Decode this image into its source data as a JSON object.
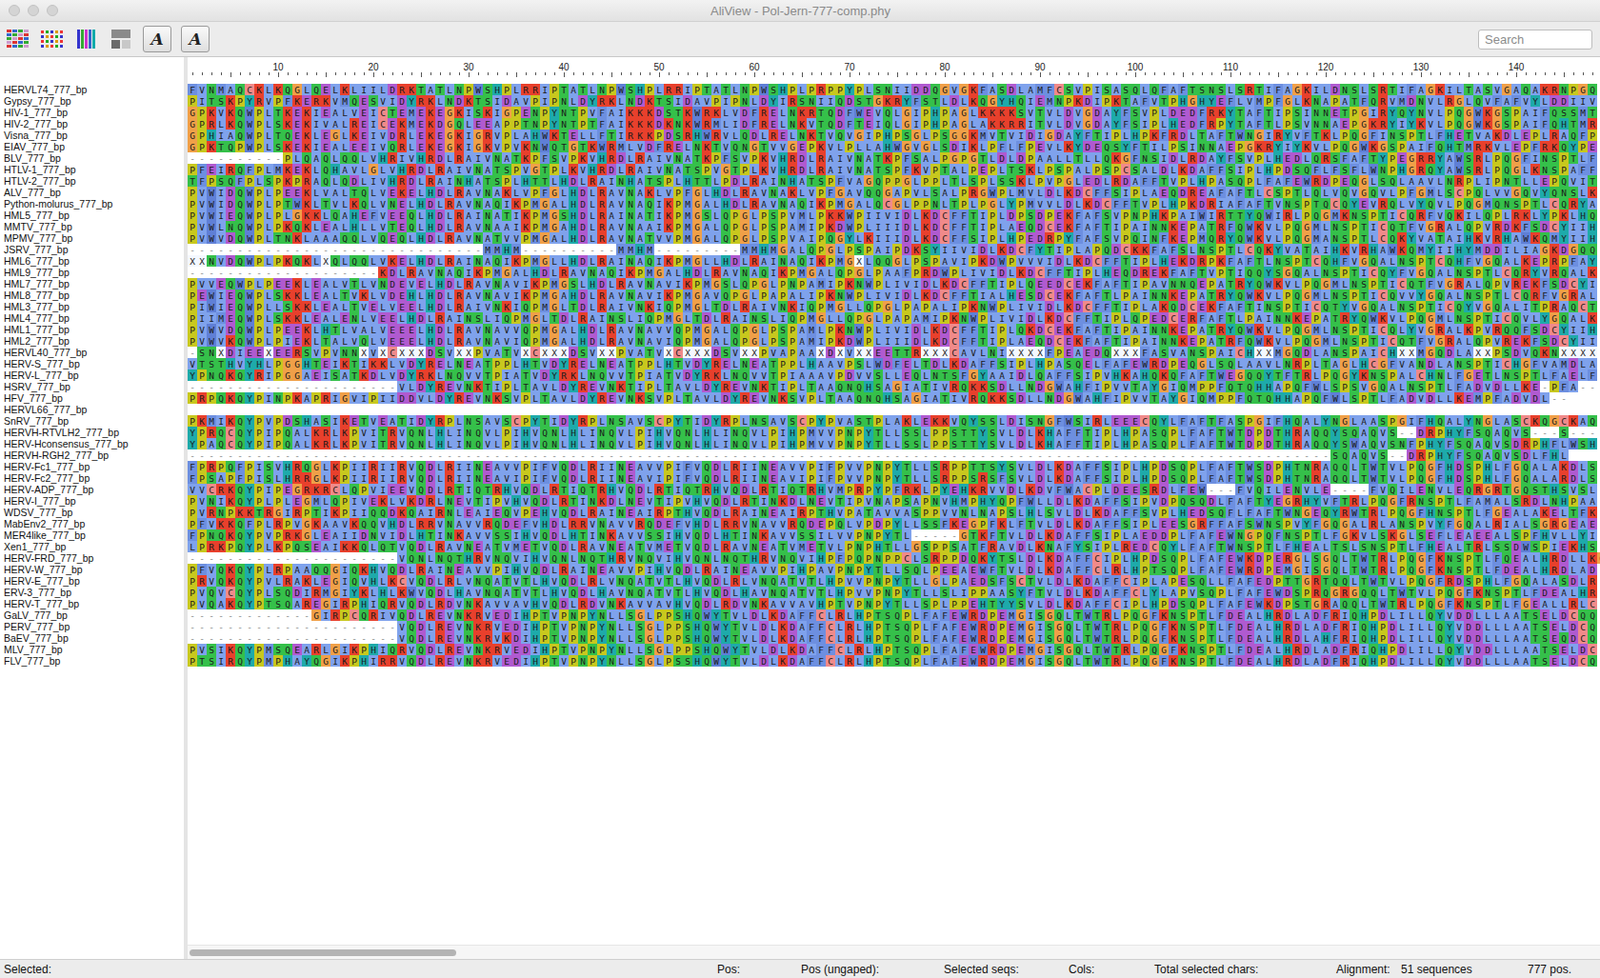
{
  "window": {
    "title": "AliView - Pol-Jern-777-comp.phy"
  },
  "toolbar": {
    "font_buttons": [
      "A",
      "A"
    ]
  },
  "search": {
    "placeholder": "Search"
  },
  "ruler": {
    "labels": [
      "10",
      "20",
      "30",
      "40",
      "50",
      "60",
      "70",
      "80",
      "90",
      "100",
      "110",
      "120",
      "130",
      "140"
    ]
  },
  "sequences": [
    {
      "name": "HERVL74_777_bp",
      "residues": "FVNMAQCKLKQGLQELKLIILDRKTATLNPWSHPLRRIPTATLNPWSHPLRRIPTATLNPWSHPLPRPPYPLSNIIDDQGVGKFASDLAMFCSVPISASQLQFAFTSNSLSRTIFAGKILDNSLSRTIFAGKILTASVGAQAKRNPGQ"
    },
    {
      "name": "Gypsy_777_bp",
      "residues": "PITSKPYRVPFKERKVMQESVIDYRKLNDKTSIDAVPIPNLDYRKLNDKTSIDAVPIPNLDYIRSNIIQDSTGKRYFSTLDLKQGYHQIEMNPKDIPKTAFVTPHGHYEFLVMPFGLKNAPATFQRVMDNVLRGLQVFAFVYLDDIIV"
    },
    {
      "name": "HIV-1_777_bp",
      "residues": "GPKVKQWPLTKEKIEALVEICTEMEKEGKISKIGPENPYNTPVFAIKKKDSTKWRKLVDFRELNKRTQDFWEVQLGIPHPAGLKKKKSVTVLDVGDAYFSVPLDEDFRKYTAFTIPSINNETPGIRYQYNVLPQGWKGSPAIFQSSMT"
    },
    {
      "name": "HIV-2_777_bp",
      "residues": "GPRLKQWPLSKEKIVALREICEKMEKDGQLEEAPPTNPYNTPTFAIKKKDKNKWRMLIDFRELNKVTQDFTEIQLGIPHPAGLAKKRRITVLDVGDAYFSIPLHEDFRPYTAFTLPSVNNAEPGKRYIYKVLPQGWKGSPAIFQHTMR"
    },
    {
      "name": "Visna_777_bp",
      "residues": "GPHIAQWPLTQEKLEGLKEIVDRLEKEGKIGRVPLAHWKTELLFTIRKKPDSRHWRVLQDLRELNKTVQVGIPHPSGLPSGGKMVTVIDIGDAYFTIPLHPKFRDLTAFTWNGIRYVFTKLPQGFINSPTLFHETVAKDLEPLRAQFP"
    },
    {
      "name": "EIAV_777_bp",
      "residues": "GPKTQPWPLSKEKIEALEEIVQRLEKEGKIGKVPVKNWQTGTKWRMLVDFRELNKTVQNGTVVGEPKVLPLLAHWGVGLSDIKLPFLFPEVLKYDEQSYFTILPSINNAEPGKRYIYKVLPQGWKGSPAIFQHTMRKVLEPFRKQYPE"
    },
    {
      "name": "BLV_777_bp",
      "residues": "----------PLQAQLQQLVHRIVHRDLRAIVNATKPFSVPKVHRDLRAIVNATKPFSVPKVHRDLRAIVNATKPFSALPGPGTLDLDPAALLTLLQKGFNSIDLRDAYFSVPLHEDLQRSFAFTYPEGRRYAWSRLPQGFINSPTLF"
    },
    {
      "name": "HTLV-1_777_bp",
      "residues": "PFEIRQFPLMKEKLQHAVLGLVHRDLRAIVNATSPVGTPLKVHRDLRAIVNATSPVGTPLKVHRDLRAIVNATSPFKVPTALPEPLTSKLPSPALPSPCSALDLKDAFFSIPLHPDSQFLFSFLWNPHGRQYAWSRLPQGLKNSPAFF"
    },
    {
      "name": "HTLV-2_777_bp",
      "residues": "TFPSQFPLSPKPRAQLQDLIVHRDLRAINHATSPLHTTLHDLRAINHATSPLHTTLPDLRAINHATSPFVAGQPPGLPPLTLSPLSSKLPVPGLEDLRDAFFTVPLHPASQPLFAFEWRDPEQGLSQLAAVLNRPLIPNTLLEPQVIT"
    },
    {
      "name": "ALV_777_bp",
      "residues": "PVWIDQWPLPEEKLVALTQLVEKELHDLRAVNAKLVPFGLHDLRAVNAKLVPFGLHDLRAVNAKLVPFGAVQQGAPVLSALPRGWPLMVLDLKDCFFSIPLAEQDREAFAFTLCSPTLQLVQVGQVLPFGMLSCPQLVVGQVYQNSLK"
    },
    {
      "name": "Python-molurus_777_bp",
      "residues": "PVWIDQWPLPTWKLTVLKQLVNELHDLRAVNAQIKPMGALHDLRAVNAQIKPMGALHDLRAVNAQIKPMGALQCGLPPNLTPLPGLYPMVVLDLKDCFFTVPLHPKDRIAFAFTVNSPTQCQYEVRQLVYQVLPQGMQNSPTLCQRYA"
    },
    {
      "name": "HML5_777_bp",
      "residues": "PVWIEQWPLPLGKKLQAHEFVEEQLHDLRAINATIKPMGSHDLRAINATIKPMGSLQPGLPSPVMLPKKWPIIVIDLKDCFFTIPLDPSDPEKFAFSVPNPHKPAIWIRTTYQWIRLPQGMKNSPTICQRFVQKILQPLRKLYPKLHQ"
    },
    {
      "name": "MMTV_777_bp",
      "residues": "PVWLNQWPLPKQKLEALHLLVTEQLHDLRAVNAAIKPMGAHDLRAVNAAIKPMGALQPGLPSPAMIPKDWPLIIIDLKDCFFTIPLAEQDCEKFAFTIPAINNKEPATRFQWKVLPQGMLNSPTICQTFVGRALQPVRDKFSDCYIIH"
    },
    {
      "name": "MPMV_777_bp",
      "residues": "PVWVDQWPLTNKLAAAQQLVQEQLHDLRAVNATVVPMGALHDLRAVNATVVPMGALQPGLPSPVAIPQGYLKIIIDLKDCFFSIPLHPEDRPYFAFSVPQINFKEPMQRYQWKVLPQGMANSPTLCQKYVATAIHKVRHAWKQMYIIH"
    },
    {
      "name": "JSRV_777_bp",
      "residues": "-------------------------------MMHM----------MMHM---------MMHMGALQPGLPSPAIPDKSYIIVIDLKDCFYTIPLAPQDCKKFAFSLNSPTLCQKYVATAIHKVRHAWKQMYIIHYMDDILIAGKDGQQ"
    },
    {
      "name": "HML6_777_bp",
      "residues": "XXNVDQWPLPKQKLXQLQQLVKELHDLRAINAQIKPMGLLHDLRAINAQIKPMGLLHDLRAINAQIKPMGXLQQGLPSPAVIPKDWPVVVIDLKDCFFTIPLHEKDRPKFAFTLNSPTCQHFVGQALNSPTCQHFVGQALKEPRPFAY"
    },
    {
      "name": "HML9_777_bp",
      "residues": "--------------------KDLRAVNAQIKPMGALHDLRAVNAQIKPMGALHDLRAVNAQIKPMGALQPGLPAAFPRDWPLIVIDLKDCFFTIPLHEQDREKFAFTVPTIQQYSGQALNSPTICQYFVGQALNSPTLCQRYVRQALK"
    },
    {
      "name": "HML7_777_bp",
      "residues": "PVVEQWPLPEEKLEALVTLVNDEVELHDLRAVNAVIKPMGSLHDLRAVNAVIKPMGSLQPGLPNPAMIPKNWPLIVIDLKDCFFTIPLQEEDCEKFAFTIPAVNNQEPATRYQWKVLPQGMLNSPTICQTFVGRALQPVREKFSDCYI"
    },
    {
      "name": "HML8_777_bp",
      "residues": "PEWIEQWPLSKKLEALTVKLVDEHLHDLRAVNAVIKPMGAHDLRAVNAVIKPMGAVQPGLPAPALIPKNWPLIVIDLKDCFFTIALHESDCEKFAFTLPAINNKEPATRYQWKVLPQGMLNSPTICQVVYGQALNSPTLCQRFVGRAL"
    },
    {
      "name": "HML3_777_bp",
      "residues": "PIWIEQWPLLSKKLEALTVELVEELHDLRAIVNKIQPMGLTDLRAIVNKIQPMGLTDLRAIVNKIQPMGLLQPGLPAPALIPKNWPLIVIDLKDCFFTIPLAKQDCEKFAFTINSPTICQTYVGQALNSPTICQYVGQALITPRAQCT"
    },
    {
      "name": "HML4_777_bp",
      "residues": "PIIMEQWPLSKKLEALENLVEELHDLRAINSLIQPMGLTDLRAINSLIQPMGLTDLRAINSLIQPMGLLQPGLPAPAMIPKNWPLIVIDLKDCFFTIPLQPEDCERFAFTLPAINNKEPATRYQWKVLPQGMLNSPTICQVLYGQALK"
    },
    {
      "name": "HML1_777_bp",
      "residues": "PVWVDQWPLPEEKLHTLVALVEEELHDLRAVNAVVQPMGALHDLRAVNAVVQPMGALQPGLPSPAMLPKNWPLIVIDLKDCFFTIPLQKDCEKFAFTIPAINNKEPATRYQWKVLPQGMLNSPTICQLYVGRALKPVRQQFSDCYIIH"
    },
    {
      "name": "HML2_777_bp",
      "residues": "PVWVKQWPLPIEKLTALVQLVEEELHDLRAVNAVIQPMGALHDLRAVNAVIQPMGALQPGLPSPAMIPKDWPLIIIDLKDCFFTIPLAEQDCEKFAFTIPAINNKEPATRFQWKVLPQGMLNSPTICQTFVGRALQPVREKFSDCYII"
    },
    {
      "name": "HERVL40_777_bp",
      "residues": "-SNXDIEEXEERSVPVNNXVXCXXXDSVXXPVATVXCXXXDSVXXPVATVXCXXXDSVXXPVAPAAXDXVXXEETTRXXXCAVLNIXXXXFPEAEDQXXXFASVANSPAICHXXMGQDLANSPAICHXXMGQDLAXXPSDVQKNXXXX"
    },
    {
      "name": "HERV-S_777_bp",
      "residues": "VTSTHVYHLPGGHTEIKTIKKLVDYRELNEATPPLHTVDYRELNEATPPLHTVDYRELNEATPPLHAAVPSLWDFELTDLKDAFFSIPLHPASQELFAFEWRDPEQGLSQLAAVLNRPLTAGLHCGFVANDLANSPTICHGFVAMDLA"
    },
    {
      "name": "HERV-L_777_bp",
      "residues": "YPNQKQYRIPGGAEISATKDLVDYRKLNQVVTPIATVDYRKLNQVVTPIATVDYRKLNQVVTPIAAAVPDVVSLLEQLNTSFGYAAIDLQAFFSIPVHKAHQKQFAFTWEGQQYTFTRLPQGYKNSPALCHNLFGETLNSPTLFAELF"
    },
    {
      "name": "HSRV_777_bp",
      "residues": "----------------------VLDYREVNKTIPLTAVLDYREVNKTIPLTAVLDYREVNKTIPLTAAQNQHSAGIATIVRQKKSDLLNDGWAHFIPVVTAYGIQMPPFQTQHHAPQFWLSPSVGQALNSPTLFADVDLLKE-PFA---"
    },
    {
      "name": "HFV_777_bp",
      "residues": "PRPQKQYPINPKAPRIGVIPIIDDVLDYREVNKSVPLTAVLDYREVNKSVPLTAVLDYREVNKSVPLTAAQNQHSAGIATIVRQKKSDLLNDGWAHFIPVVTAYGIQMPPFQTQHHAPQFWLSPTLFADVDLLKEMPFADVDL--"
    },
    {
      "name": "HERVL66_777_bp",
      "residues": ""
    },
    {
      "name": "SnRV_777_bp",
      "residues": "PKMIKQYPVPDSHASIKETVEATIDYRPLNSAVSCPYTIDYRPLNSAVSCPYTIDYRPLNSAVSCPYPVASTPLAKLEKKVQYSSLDISNGFWSIRLEEECQYLFAFTFASPGIFHQALYNGLAASPGIFHQALYNGLASCKQGCKAQ"
    },
    {
      "name": "HERVH-RTVLH2_777_bp",
      "residues": "YPRQCQYPIPQALKRLKPVITRVQNLHLINQVLPIHVQNLHLINQVLPIHVQNLHLINQVLPIHPMVVPNPYTLLSSLPPSTTYSVLDLKHAFFTIPLHPASQPLFAFTWTDPDTHRAQQYSQAQVS--DRPHYFSQAQVS---S---"
    },
    {
      "name": "HERV-Hconsensus_777_bp",
      "residues": "YPAQCQYPIPQALKRLKPVITRVQNLHLINQVLPIHVQNLHLINQVLPIHVQNLHLINQVLPIHPMVVPNPYTLLSSLPPSTTYSVLDLKHAFFTIPLHPASQPLFAFTWTDPDTHRAQQYSWAQVSNFPHYFSQAQVSDRPHFLWSH"
    },
    {
      "name": "HERVH-RGH2_777_bp",
      "residues": "------------------------------------------------------------------------------------------------------------------------SQAQVS--DRPHYFSQAQVSDLFHL"
    },
    {
      "name": "HERV-Fc1_777_bp",
      "residues": "FPRPQFPISVHRQGLKPIIRIIRVQDLRIINEAVVPIFVQDLRIINEAVVPIFVQDLRIINEAVVPIFPVVPNPYTLLSRPPTTSYSVLDLKDAFFSIPLHPDSQPLFAFTWSDPHTNRAQQLTWTVLPQGFHDSPHLFGQALAKDLS"
    },
    {
      "name": "HERV-Fc2_777_bp",
      "residues": "FPSAPFPISLHRRGLKPIIRIIRVQDLRIINEAVIPIFVQDLRIINEAVIPIFVQDLRIINEAVIPIFPVVPNPYTLLSRPPSRSFSVLDLKDAFFSIPLHPDSQPLFAFTWSDPHTNRAQQLTWTVLPQGFHDSPHLFGQALARDLS"
    },
    {
      "name": "HERV-ADP_777_bp",
      "residues": "VVCRKQYPIPEGRKRCLQPVIEEVQDLRTIQTRHVQDLRTIQTRHVQDLRTIQTRHVQDLRTIQTRHVMPRPYPFRKLPYEHKRVVDLKDVFWACPLDEESRDLFEW---FVQILENVLE----FVQILENVLEQRGRTGQSTHSVSL"
    },
    {
      "name": "HERV-I_777_bp",
      "residues": "PVNIKQYPLPLEGMLQPIVEKLVKDRLNEVTIPVHVQDLRTINKDLNEVTIPVHVQDLRTINKDLNEVTIPVNAPSAPNVHMPHYQPFWLLDLKDAFFSIPVDPQSQDLFAFTYEGRHYVFTRLPQGFRNSPTLFAMALSRDLNHPAA"
    },
    {
      "name": "WDSV_777_bp",
      "residues": "PVRNPKKTRGIRPTIKPIIQQDKQAIRNLEAIEQVPEHVQDLRAINEAIRPTHVQDLRAINEAIRPTHVPATAVVASPPVVNLNAPSLHLSVLDLKDAFFSVPLHEDSQFLFAFTWNGEQYRWTRLPQGFHNSPTLFGEALAKELTFK"
    },
    {
      "name": "MabEnv2_777_bp",
      "residues": "PFVKKQFPLRPVGKAAVKQQVHDLRRVNAVVRQDEFVHDLRRVNAVVRQDEFVHDLRRVNAVVRQDEPQLVPDPYLLSSFKEGPFKLFTVLDLKDAFFSIPLEESGRFFAFSWNSPVYFGQGALRLANSPVYFGQALRIALSGRGEAE"
    },
    {
      "name": "MER4like_777_bp",
      "residues": "FPNQKQYPVPRKGLEAIIDNVIDLHTINKAVVSSIHVQDLHTINKAVVSSIHVQDLHTINKAVVSSILVVPNPYTL-----GTKFTVLDLKDAFFSIPLAEDDPLFAFEWNGPQFNSPTLFGKVLSKGLSEFLEAEEALSPFHVLLYI"
    },
    {
      "name": "Xen1_777_bp",
      "residues": "LPRKPQYPLKPQSEAIKKQLQTVQDLRAVNEATVMETVQDLRAVNEATVMETVQDLRAVNEATVMETVLPNPHTLLGSPPSATFRAVDLKNAFYSIPLREDCQYLFAFTWNSPTLFHEALTSLSNSPTLFHEALTRLSSDWSPIEKHS"
    },
    {
      "name": "HERV-FRD_777_bp",
      "residues": "----------------------VQNLNQTHRVNQVIHVQNLNQTHRVNQVIHVQNLNQTHRVNQVIHPFPQPNPPCLSRPPDQKYTSLDLKDAFFCIPLHPDSQPLFAFEWKDPERGLSGQLTWTRLPQGFKNSPTLFQEALHRDLLKGG"
    },
    {
      "name": "HERV-W_777_bp",
      "residues": "PFVQKQYPLRPAAQQGIQKHVQDLRAINEAVVPIHVQDLRAINEAVVPIHVQDLRAINEAVVPIHPAVPNPYTLLSQLPEEAEWFTVLDLKDAFFCLRLHPTSQPLFAFEWRDPEMGISGQLTWTRLPQGFKNSPTLFDEALHRDLAD"
    },
    {
      "name": "HERV-E_777_bp",
      "residues": "PRVQKQYPVLRAKLEGIQVHLKCVQDLRLVNQATVTLHVQDLRLVNQATVTLHVQDLRLVNQATVTLHPVVPNPYTLLGLPAEDSFSCTVLDLKDAFFCIPLAPESQLLFAFEDPTTGRTQQLTWTVLPQGFRDSPHLFGQALASDLR"
    },
    {
      "name": "ERV-3_777_bp",
      "residues": "PVQVCQYPLSQDIRMGIYKLHLKWVQDLHAVNQATVTLHVQDLHAVNQATVTLHVQDLHAVNQATVTLHPVVPNPYTLLSLIPPAASYFTVLDLKDAFFCLYLAPVSQPLFAFEWDSPRQGRGQQLTWTVLPQGFKNSPTLFDEALHR"
    },
    {
      "name": "HERV-T_777_bp",
      "residues": "PVQAKQYPTSQAREGIRPHIQRVQDLRDVNKAVVAVHVQDLRDVNKAVVAVHVQDLRDVNKAVVAVHPTVPNPYTLLSPLPPEHTYYSVLDLKDAFFCIPLHPDSQPLFAFEWKDPSTGRAQQLTWTRLPQGFKNSPTLFGEALLRLC"
    },
    {
      "name": "GaLV_777_bp",
      "residues": "-------------GIRPCQRIVQDLREVNKRVEDIHPTVPNPYNLLSGLPPSHQWYTVLDLKDAFFCLRLHPTSQPLFAFEWRDPEMGISGQLTWTRLPQGFKNSPTLFDEALHRDLADFRIQHPDLILLQYVDDLLLAATSELDCQQ"
    },
    {
      "name": "PERV_777_bp",
      "residues": "----------------------VQDLREVNKRVEDIHPTVPNPYNLLSGLPPSHQWYTVLDLKDAFFCLRLHPTSQPLFAFEWRDPEMGISGQLTWTRLPQGFKNSPTLFDEALHRDLADFRIQHPDLILLQYVDDLLLAATSELDCQ"
    },
    {
      "name": "BaEV_777_bp",
      "residues": "----------------------VQDLREVNKRVKDIHPTVPNPYNLLSGLPPSHQWYTVLDLKDAFFCLRLHPTSQPLFAFEWRDPEMGISGQLTWTRLPQGFKNSPTLFDEALHRDLAHFRIQHPDLILLQYVDDLLLAATSEQDCQ"
    },
    {
      "name": "MLV_777_bp",
      "residues": "PVSIKQYPMSQEARLGIKPHIQRVQDLREVNKRVEDIHPTVPNPYNLLSGLPPSHQWYTVLDLKDAFFCLRLHPTSQPLFAFEWRDPEMGISGQLTWTRLPQGFKNSPTLFDEALHRDLADFRIQHPDLILLQYVDDLLLAATSELDC"
    },
    {
      "name": "FLV_777_bp",
      "residues": "PTSIRQYPMPHAYQGIKPHIRRVQDLREVNKRVEDIHPTVPNPYNLLSGLPSSHQWYTVLDLKDAFFCLRLHPTSQPLFAFEWRDPEMGISGQLTWTRLPQGFKNSPTLFDEALHRDLADFRIQHPDLILLQYVDDLLLAATSELDCQ"
    }
  ],
  "status_bar": {
    "fields": [
      "Selected:",
      "Pos:",
      "Pos (ungaped):",
      "Selected seqs:",
      "Cols:",
      "Total selected chars:",
      "Alignment:",
      "51 sequences",
      "777 pos."
    ]
  }
}
